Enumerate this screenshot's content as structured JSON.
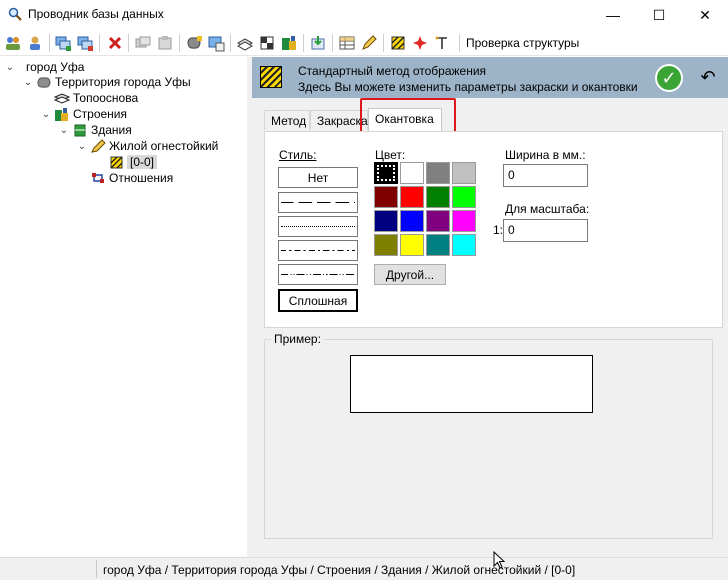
{
  "window": {
    "title": "Проводник базы данных",
    "minimize": "—",
    "maximize": "☐",
    "close": "✕"
  },
  "toolbar": {
    "check_structure": "Проверка структуры"
  },
  "tree": {
    "root": "город Уфа",
    "territory": "Территория города Уфы",
    "topo": "Топооснова",
    "buildings_group": "Строения",
    "buildings": "Здания",
    "residential": "Жилой огнестойкий",
    "style_item": "[0-0]",
    "relations": "Отношения"
  },
  "info": {
    "line1": "Стандартный метод отображения",
    "line2": "Здесь Вы можете изменить параметры закраски и окантовки"
  },
  "tabs": {
    "method": "Метод",
    "fill": "Закраска",
    "outline": "Окантовка",
    "active": "outline"
  },
  "outline": {
    "style_label": "Стиль:",
    "style_none": "Нет",
    "style_solid": "Сплошная",
    "color_label": "Цвет:",
    "other_button": "Другой...",
    "width_label": "Ширина в мм.:",
    "width_value": "0",
    "scale_label": "Для масштаба:",
    "scale_prefix": "1:",
    "scale_value": "0",
    "palette": [
      "#000000",
      "#ffffff",
      "#808080",
      "#c0c0c0",
      "#800000",
      "#ff0000",
      "#008000",
      "#00ff00",
      "#000080",
      "#0000ff",
      "#800080",
      "#ff00ff",
      "#808000",
      "#ffff00",
      "#008080",
      "#00ffff"
    ],
    "selected_color": "#000000"
  },
  "sample": {
    "label": "Пример:"
  },
  "status": {
    "path": "город Уфа / Территория города Уфы / Строения / Здания / Жилой огнестойкий / [0-0]"
  }
}
